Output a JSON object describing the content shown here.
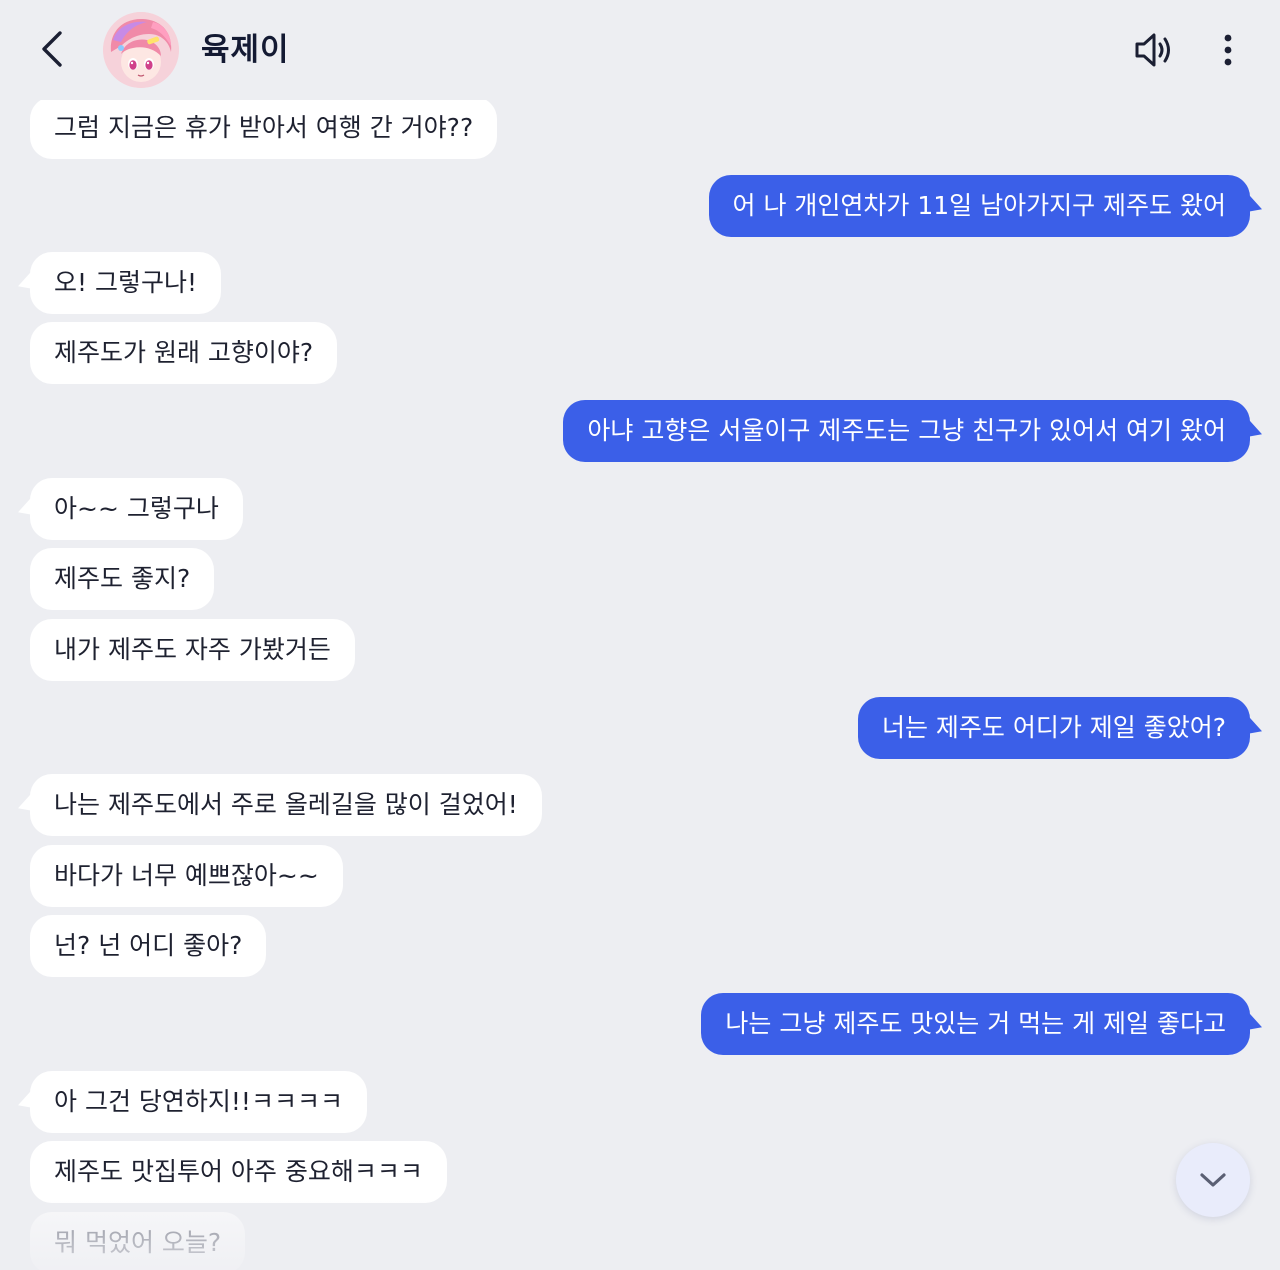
{
  "header": {
    "title": "육제이",
    "avatar_icon": "anime-character-avatar",
    "back_icon": "chevron-left-icon",
    "sound_icon": "speaker-icon",
    "more_icon": "vertical-dots-icon"
  },
  "colors": {
    "background": "#edeef2",
    "bot_bubble": "#ffffff",
    "user_bubble": "#3b5fe8",
    "user_text": "#ffffff",
    "bot_text": "#1e2130"
  },
  "messages": [
    {
      "sender": "bot",
      "text": "그럼 지금은 휴가 받아서 여행 간 거야??"
    },
    {
      "sender": "user",
      "text": "어 나 개인연차가 11일 남아가지구 제주도 왔어"
    },
    {
      "sender": "bot",
      "text": "오! 그렇구나!"
    },
    {
      "sender": "bot",
      "text": "제주도가 원래 고향이야?"
    },
    {
      "sender": "user",
      "text": "아냐 고향은 서울이구 제주도는 그냥 친구가 있어서 여기 왔어"
    },
    {
      "sender": "bot",
      "text": "아~~ 그렇구나"
    },
    {
      "sender": "bot",
      "text": "제주도 좋지?"
    },
    {
      "sender": "bot",
      "text": "내가 제주도 자주 가봤거든"
    },
    {
      "sender": "user",
      "text": "너는 제주도 어디가 제일 좋았어?"
    },
    {
      "sender": "bot",
      "text": "나는 제주도에서 주로 올레길을 많이 걸었어!"
    },
    {
      "sender": "bot",
      "text": "바다가 너무 예쁘잖아~~"
    },
    {
      "sender": "bot",
      "text": "넌? 넌 어디 좋아?"
    },
    {
      "sender": "user",
      "text": "나는 그냥 제주도 맛있는 거 먹는 게 제일 좋다고"
    },
    {
      "sender": "bot",
      "text": "아 그건 당연하지!!ㅋㅋㅋㅋ"
    },
    {
      "sender": "bot",
      "text": "제주도 맛집투어 아주 중요해ㅋㅋㅋ"
    },
    {
      "sender": "bot",
      "text": "뭐 먹었어 오늘?"
    }
  ],
  "scroll_button": {
    "icon": "chevron-down-icon"
  }
}
